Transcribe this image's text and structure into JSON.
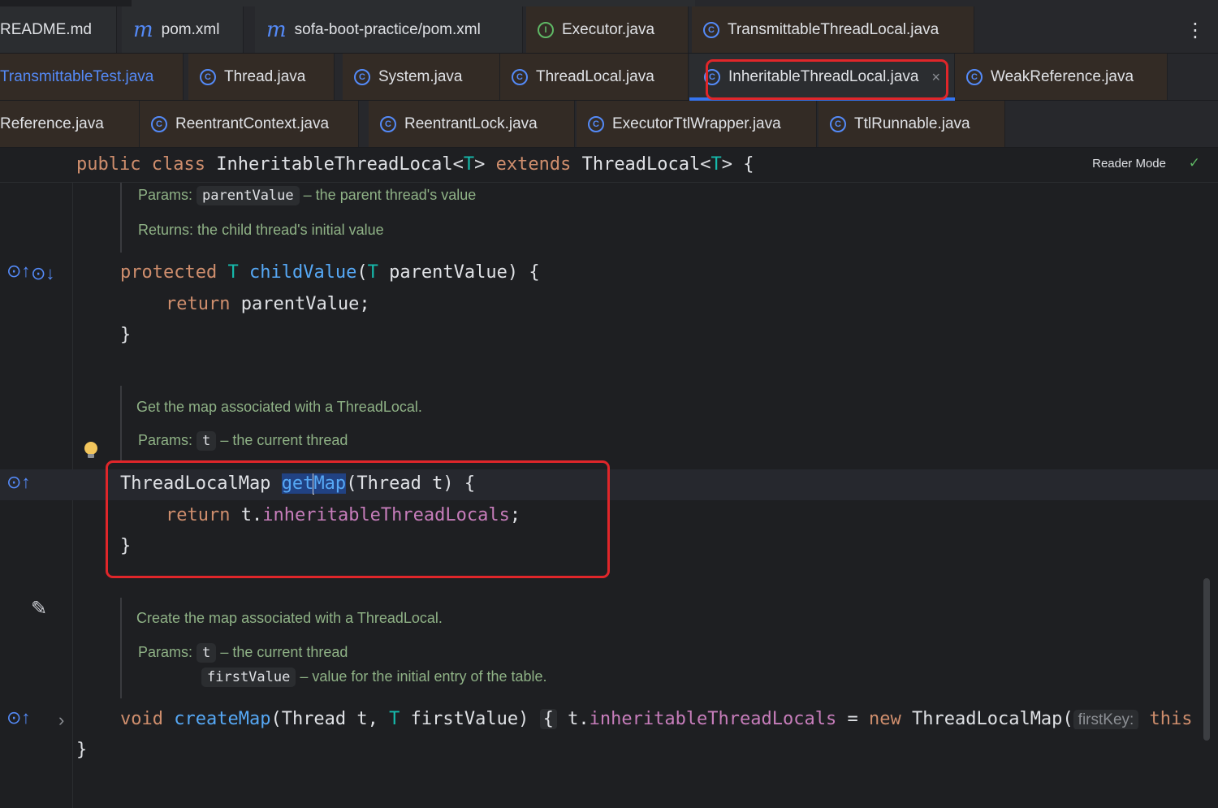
{
  "tabs_row1": [
    {
      "label": "README.md",
      "icon": "markdown-icon"
    },
    {
      "label": "pom.xml",
      "icon": "maven-icon",
      "glyph": "m"
    },
    {
      "label": "sofa-boot-practice/pom.xml",
      "icon": "maven-icon",
      "glyph": "m"
    },
    {
      "label": "Executor.java",
      "icon": "interface-icon",
      "glyph": "I"
    },
    {
      "label": "TransmittableThreadLocal.java",
      "icon": "class-icon",
      "glyph": "C"
    }
  ],
  "tabs_row2": [
    {
      "label": "TransmittableTest.java"
    },
    {
      "label": "Thread.java",
      "glyph": "C"
    },
    {
      "label": "System.java",
      "glyph": "C"
    },
    {
      "label": "ThreadLocal.java",
      "glyph": "C"
    },
    {
      "label": "InheritableThreadLocal.java",
      "glyph": "C",
      "close": "×"
    },
    {
      "label": "WeakReference.java",
      "glyph": "C"
    }
  ],
  "tabs_row3": [
    {
      "label": "Reference.java"
    },
    {
      "label": "ReentrantContext.java",
      "glyph": "C"
    },
    {
      "label": "ReentrantLock.java",
      "glyph": "C"
    },
    {
      "label": "ExecutorTtlWrapper.java",
      "glyph": "C"
    },
    {
      "label": "TtlRunnable.java",
      "glyph": "C"
    }
  ],
  "more_menu": "⋮",
  "sticky": {
    "kw_public": "public",
    "kw_class": "class",
    "class_name": "InheritableThreadLocal<",
    "t1": "T",
    "close1": ">",
    "kw_extends": "extends",
    "parent": "ThreadLocal<",
    "t2": "T",
    "close2": "> {",
    "reader_mode": "Reader Mode",
    "check": "✓"
  },
  "doc1": {
    "params_label": "Params:",
    "param": "parentValue",
    "param_desc": "– the parent thread's value",
    "returns_label": "Returns:",
    "returns_desc": "the child thread's initial value"
  },
  "childValue": {
    "kw": "protected",
    "type": "T",
    "name": "childValue",
    "open": "(",
    "ptype": "T",
    "rest": " parentValue) {",
    "ret_kw": "return",
    "ret_val": " parentValue;",
    "close": "}"
  },
  "doc2": {
    "summary": "Get the map associated with a ThreadLocal.",
    "params_label": "Params:",
    "param": "t",
    "param_desc": "– the current thread"
  },
  "getMap": {
    "type": "ThreadLocalMap ",
    "sel_a": "get",
    "sel_b": "Map",
    "rest": "(Thread t) {",
    "ret_kw": "return",
    "ret_obj": " t.",
    "ret_field": "inheritableThreadLocals",
    "semi": ";",
    "close": "}"
  },
  "doc3": {
    "summary": "Create the map associated with a ThreadLocal.",
    "params_label": "Params:",
    "param1": "t",
    "param1_desc": "– the current thread",
    "param2": "firstValue",
    "param2_desc": "– value for the initial entry of the table."
  },
  "createMap": {
    "kw": "void",
    "name": "createMap",
    "open": "(Thread t, ",
    "ptype": "T",
    "rest": " firstValue)",
    "brace": "{",
    "obj": " t.",
    "field": "inheritableThreadLocals",
    "assign": " = ",
    "kw_new": "new",
    "ctor": " ThreadLocalMap(",
    "hint": "firstKey:",
    "this": " this"
  },
  "class_close": "}",
  "gutter": {
    "override_up": "⊙↑",
    "override_down": "⊙↓",
    "pencil": "✎",
    "chevron": "›"
  }
}
